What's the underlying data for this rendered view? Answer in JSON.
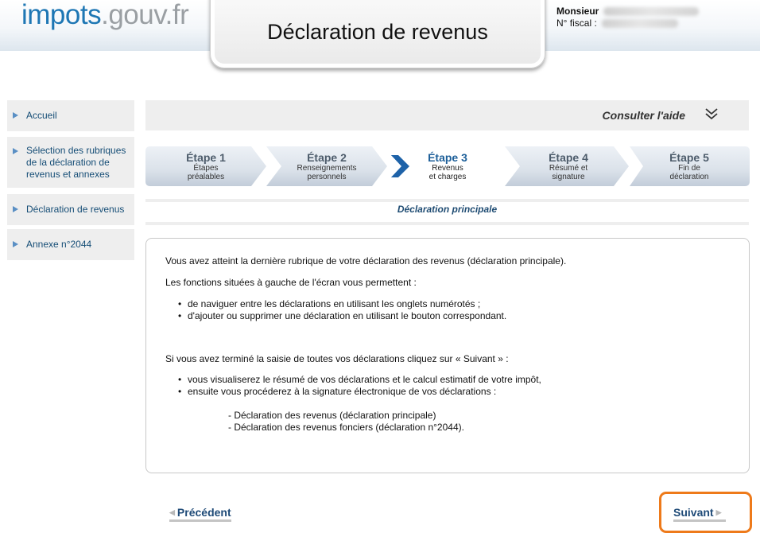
{
  "header": {
    "logo_part1": "impots",
    "logo_part2": ".gouv.fr",
    "title": "Déclaration de revenus",
    "user_label": "Monsieur",
    "fiscal_label": "N° fiscal :"
  },
  "sidebar": {
    "items": [
      {
        "label": "Accueil"
      },
      {
        "label": "Sélection des rubriques de la déclaration de revenus et annexes"
      },
      {
        "label": "Déclaration de revenus"
      },
      {
        "label": "Annexe n°2044"
      }
    ]
  },
  "aide": {
    "label": "Consulter l'aide"
  },
  "steps": [
    {
      "title": "Étape 1",
      "sub1": "Étapes",
      "sub2": "préalables"
    },
    {
      "title": "Étape 2",
      "sub1": "Renseignements",
      "sub2": "personnels"
    },
    {
      "title": "Étape 3",
      "sub1": "Revenus",
      "sub2": "et charges"
    },
    {
      "title": "Étape 4",
      "sub1": "Résumé et",
      "sub2": "signature"
    },
    {
      "title": "Étape 5",
      "sub1": "Fin de",
      "sub2": "déclaration"
    }
  ],
  "section_title": "Déclaration principale",
  "content": {
    "p1": "Vous avez atteint la dernière rubrique de votre déclaration des revenus (déclaration principale).",
    "p2": "Les fonctions situées à gauche de l'écran vous permettent :",
    "b1": "de naviguer entre les déclarations en utilisant les onglets numérotés ;",
    "b2": "d'ajouter ou supprimer une déclaration en utilisant le bouton correspondant.",
    "p3": "Si vous avez terminé la saisie de toutes vos déclarations cliquez sur « Suivant » :",
    "b3": "vous visualiserez le résumé de vos déclarations et le calcul estimatif de votre impôt,",
    "b4": "ensuite vous procéderez à la signature électronique de vos déclarations :",
    "d1": "- Déclaration des revenus (déclaration principale)",
    "d2": "- Déclaration des revenus fonciers (déclaration n°2044)."
  },
  "nav": {
    "prev_label": "Précédent",
    "next_label": "Suivant"
  },
  "colors": {
    "accent": "#1e77b4",
    "highlight": "#ee7a1a"
  }
}
